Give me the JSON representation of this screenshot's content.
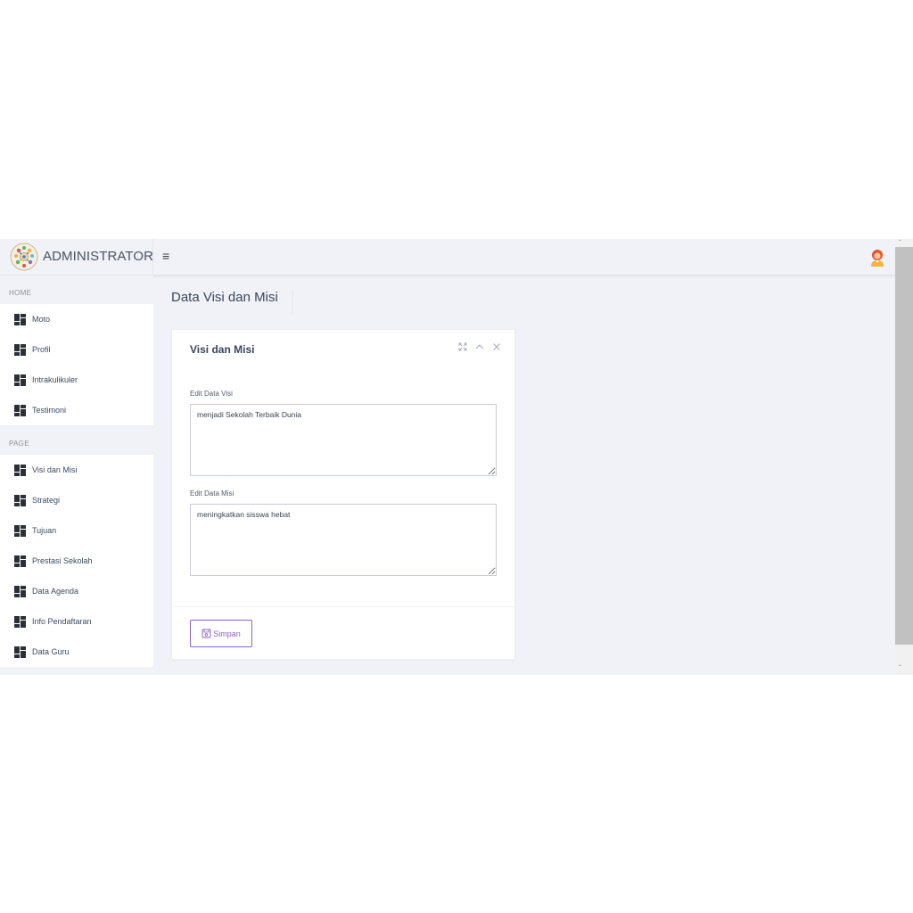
{
  "app": {
    "title": "ADMINISTRATOR",
    "menu_icon": "hamburger-icon",
    "avatar_icon": "user-avatar-icon"
  },
  "sidebar": {
    "sections": [
      {
        "label": "HOME",
        "items": [
          {
            "label": "Moto",
            "icon": "dashboard-icon"
          },
          {
            "label": "Profil",
            "icon": "dashboard-icon"
          },
          {
            "label": "Intrakulikuler",
            "icon": "dashboard-icon"
          },
          {
            "label": "Testimoni",
            "icon": "dashboard-icon"
          }
        ]
      },
      {
        "label": "PAGE",
        "items": [
          {
            "label": "Visi dan Misi",
            "icon": "dashboard-icon"
          },
          {
            "label": "Strategi",
            "icon": "dashboard-icon"
          },
          {
            "label": "Tujuan",
            "icon": "dashboard-icon"
          },
          {
            "label": "Prestasi Sekolah",
            "icon": "dashboard-icon"
          },
          {
            "label": "Data Agenda",
            "icon": "dashboard-icon"
          },
          {
            "label": "Info Pendaftaran",
            "icon": "dashboard-icon"
          },
          {
            "label": "Data Guru",
            "icon": "dashboard-icon"
          }
        ]
      }
    ]
  },
  "main": {
    "page_title": "Data Visi dan Misi",
    "card": {
      "title": "Visi dan Misi",
      "tools": [
        "expand-icon",
        "collapse-icon",
        "close-icon"
      ],
      "fields": [
        {
          "label": "Edit Data Visi",
          "value": "menjadi Sekolah Terbaik Dunia"
        },
        {
          "label": "Edit Data Misi",
          "value": "meningkatkan sisswa hebat"
        }
      ],
      "save_label": "Simpan",
      "save_icon": "save-icon"
    }
  },
  "colors": {
    "background": "#f1f2f7",
    "card": "#ffffff",
    "accent": "#8a63c7",
    "text": "#3b4a63"
  }
}
